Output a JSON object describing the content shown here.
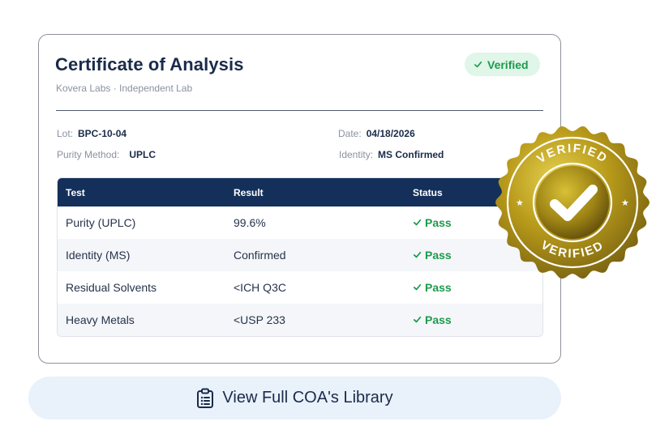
{
  "card": {
    "title": "Certificate of Analysis",
    "subtitle": "Kovera Labs · Independent Lab",
    "badge": "Verified"
  },
  "meta": {
    "lot_label": "Lot:",
    "lot_value": "BPC-10-04",
    "date_label": "Date:",
    "date_value": "04/18/2026",
    "method_label": "Purity Method:",
    "method_value": "UPLC",
    "identity_label": "Identity:",
    "identity_value": "MS Confirmed"
  },
  "table": {
    "headers": [
      "Test",
      "Result",
      "Status"
    ],
    "rows": [
      {
        "test": "Purity (UPLC)",
        "result": "99.6%",
        "status": "Pass"
      },
      {
        "test": "Identity (MS)",
        "result": "Confirmed",
        "status": "Pass"
      },
      {
        "test": "Residual Solvents",
        "result": "<ICH Q3C",
        "status": "Pass"
      },
      {
        "test": "Heavy Metals",
        "result": "<USP 233",
        "status": "Pass"
      }
    ]
  },
  "seal": {
    "text": "VERIFIED"
  },
  "button": {
    "label": "View Full COA's Library",
    "icon": "clipboard-list-icon"
  },
  "colors": {
    "navy": "#14305a",
    "green": "#1e9a4c",
    "gold": "#b49a16"
  }
}
